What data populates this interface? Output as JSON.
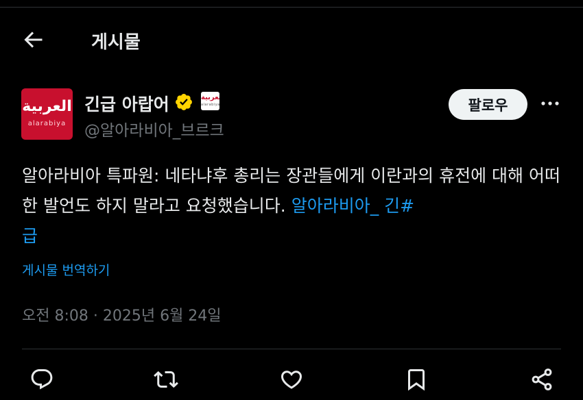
{
  "header": {
    "title": "게시물",
    "back_icon": "arrow-left-icon"
  },
  "author": {
    "name": "긴급 아랍어",
    "handle": "@알아라비아_브르크",
    "avatar_text_ar": "العربية",
    "avatar_text_en": "alarabiya",
    "affiliate_text_ar": "العربية",
    "affiliate_text_en": "alarabiya",
    "verified_color": "#ffd400"
  },
  "follow_label": "팔로우",
  "tweet": {
    "text": "알아라비아 특파원: 네타냐후 총리는 장관들에게 이란과의 휴전에 대해 어떠한 발언도 하지 말라고 요청했습니다. ",
    "hashtag": "알아라비아_ 긴#\n급",
    "link_color": "#1d9bf0"
  },
  "translate_label": "게시물 번역하기",
  "timestamp": "오전 8:08 · 2025년 6월 24일",
  "actions": [
    "reply-icon",
    "retweet-icon",
    "like-icon",
    "bookmark-icon",
    "share-icon"
  ]
}
